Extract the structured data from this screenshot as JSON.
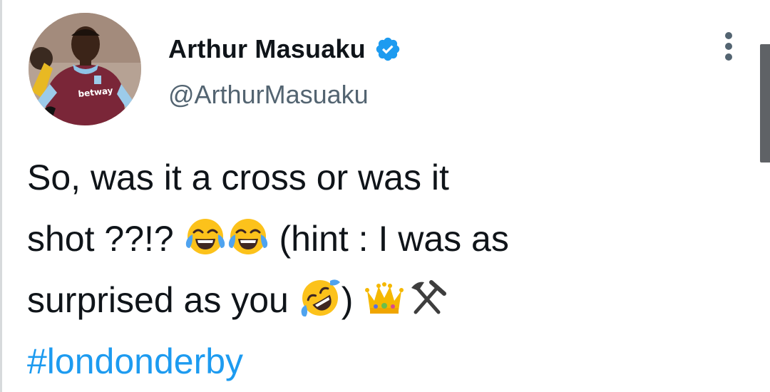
{
  "tweet": {
    "author": {
      "display_name": "Arthur Masuaku",
      "handle": "@ArthurMasuaku",
      "verified": true,
      "avatar_icon": "player-photo-avatar",
      "avatar_shirt_text": "betway"
    },
    "text": {
      "line1": "So, was it a cross or was it",
      "line2_before": "shot ??!? ",
      "line2_after": " (hint : I was as",
      "line3_before": "surprised as you ",
      "line3_after": ") ",
      "hashtag": "#londonderby"
    },
    "emojis": [
      "face-with-tears-of-joy",
      "face-with-tears-of-joy",
      "rolling-on-floor-laughing",
      "crown",
      "hammer-and-pick"
    ]
  },
  "colors": {
    "text": "#0f1419",
    "secondary_text": "#536471",
    "link": "#1d9bf0",
    "verified": "#1d9bf0",
    "scrollbar": "#5f6266"
  }
}
